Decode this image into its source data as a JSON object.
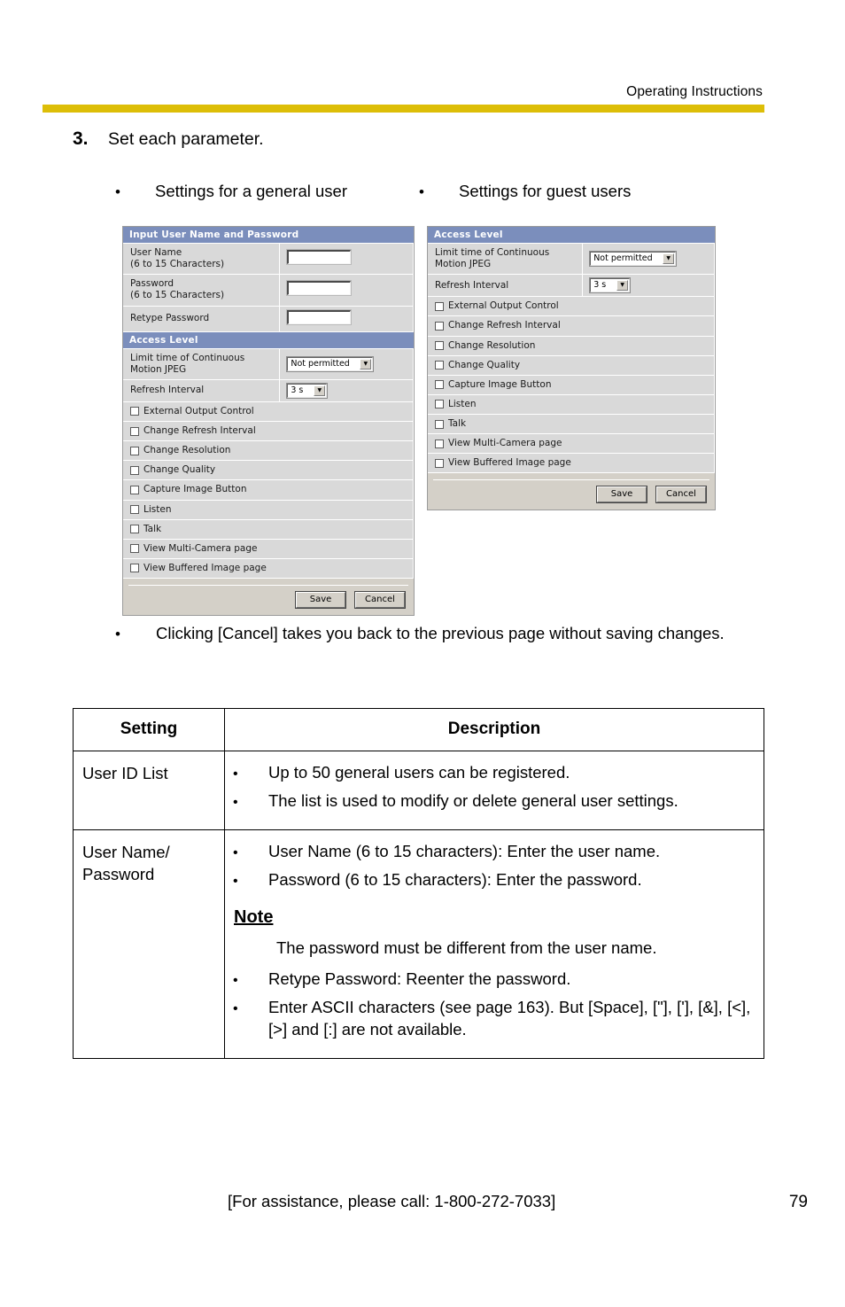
{
  "header": {
    "title": "Operating Instructions",
    "rule_color": "#ddbe08"
  },
  "step": {
    "number": "3.",
    "text": "Set each parameter."
  },
  "captions": {
    "bullet": "•",
    "left": "Settings for a general user",
    "right": "Settings for guest users"
  },
  "screenshot_left": {
    "section_input": {
      "title": "Input User Name and Password",
      "rows": [
        {
          "label_line1": "User Name",
          "label_line2": "(6 to 15 Characters)",
          "value": ""
        },
        {
          "label_line1": "Password",
          "label_line2": "(6 to 15 Characters)",
          "value": ""
        },
        {
          "label_line1": "Retype Password",
          "label_line2": "",
          "value": ""
        }
      ]
    },
    "section_access": {
      "title": "Access Level",
      "limit_label_line1": "Limit time of Continuous",
      "limit_label_line2": "Motion JPEG",
      "limit_value": "Not permitted",
      "refresh_label": "Refresh Interval",
      "refresh_value": "3 s",
      "checkboxes": [
        "External Output Control",
        "Change Refresh Interval",
        "Change Resolution",
        "Change Quality",
        "Capture Image Button",
        "Listen",
        "Talk",
        "View Multi-Camera page",
        "View Buffered Image page"
      ]
    },
    "buttons": {
      "save": "Save",
      "cancel": "Cancel"
    }
  },
  "screenshot_right": {
    "section_access": {
      "title": "Access Level",
      "limit_label_line1": "Limit time of Continuous",
      "limit_label_line2": "Motion JPEG",
      "limit_value": "Not permitted",
      "refresh_label": "Refresh Interval",
      "refresh_value": "3 s",
      "checkboxes": [
        "External Output Control",
        "Change Refresh Interval",
        "Change Resolution",
        "Change Quality",
        "Capture Image Button",
        "Listen",
        "Talk",
        "View Multi-Camera page",
        "View Buffered Image page"
      ]
    },
    "buttons": {
      "save": "Save",
      "cancel": "Cancel"
    }
  },
  "cancel_note": {
    "bullet": "•",
    "text": "Clicking [Cancel] takes you back to the previous page without saving changes."
  },
  "settings_table": {
    "headers": {
      "setting": "Setting",
      "description": "Description"
    },
    "rows": [
      {
        "setting": "User ID List",
        "bullets": [
          "Up to 50 general users can be registered.",
          "The list is used to modify or delete general user settings."
        ]
      },
      {
        "setting": "User Name/ Password",
        "bullets": [
          "User Name (6 to 15 characters): Enter the user name.",
          "Password (6 to 15 characters): Enter the password."
        ],
        "note_heading": "Note",
        "note_text": "The password must be different from the user name.",
        "bullets_after": [
          "Retype Password: Reenter the password.",
          "Enter ASCII characters (see page 163). But [Space], [\"], ['], [&], [<], [>] and [:] are not available."
        ]
      }
    ],
    "bullet": "•"
  },
  "footer": {
    "assistance": "[For assistance, please call: 1-800-272-7033]",
    "page_number": "79"
  }
}
